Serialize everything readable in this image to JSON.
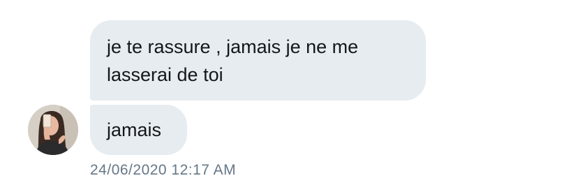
{
  "conversation": {
    "messages": [
      {
        "text": "je te rassure , jamais je ne me\nlasserai de toi"
      },
      {
        "text": "jamais"
      }
    ],
    "timestamp": "24/06/2020 12:17 AM"
  },
  "theme": {
    "bubble_color": "#e6ecf0",
    "text_color": "#14171a",
    "timestamp_color": "#657786"
  },
  "avatar": {
    "icon": "user-photo-avatar"
  }
}
